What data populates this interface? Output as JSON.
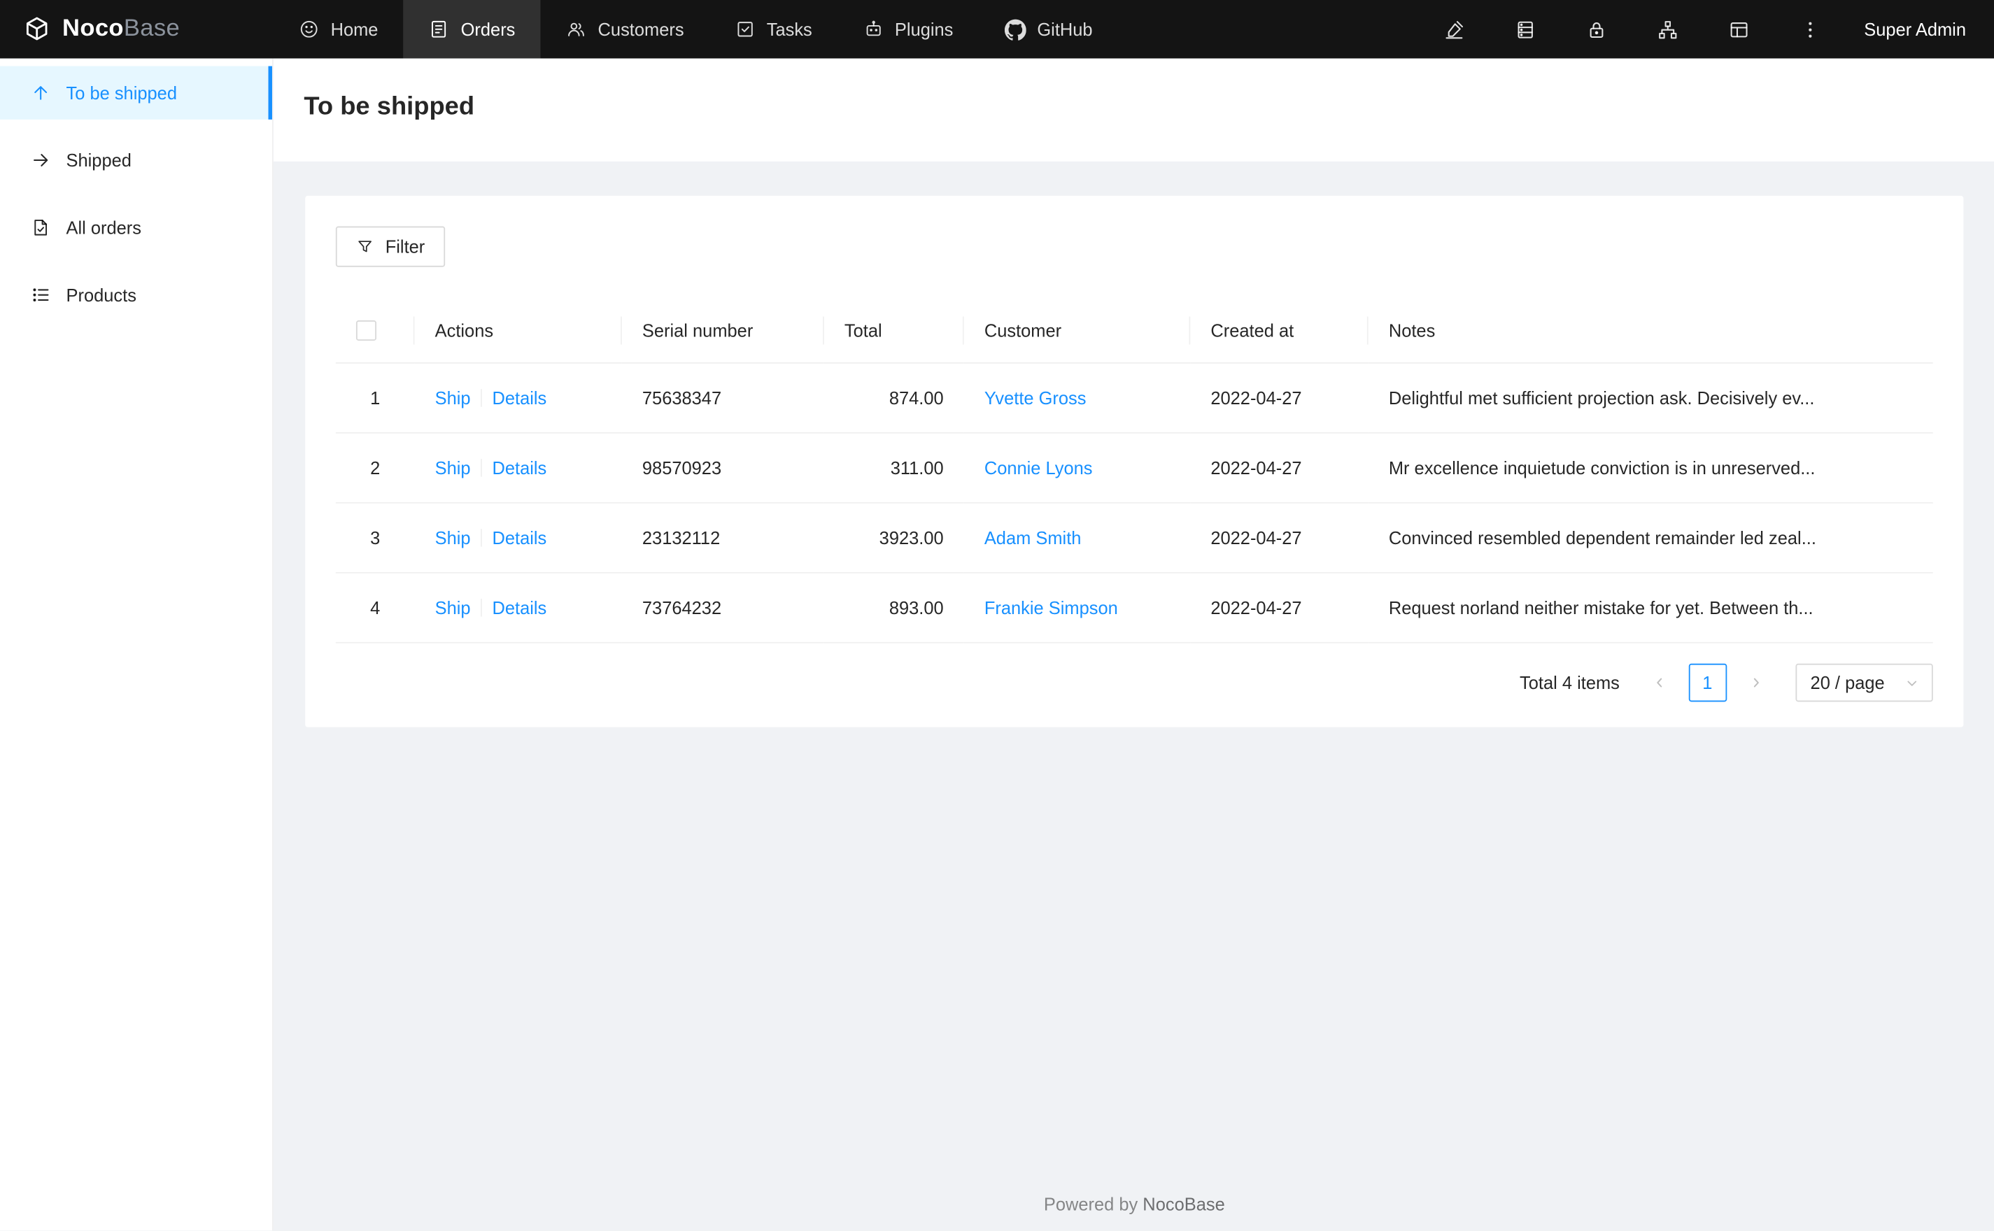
{
  "colors": {
    "accent": "#1890ff",
    "navbar_bg": "#141414",
    "sidebar_active_bg": "#e6f7ff",
    "content_bg": "#f0f2f5"
  },
  "navbar": {
    "brand_primary": "Noco",
    "brand_secondary": "Base",
    "brand_icon": "nocobase-cube-icon",
    "items": [
      {
        "label": "Home",
        "icon": "smile-icon",
        "active": false
      },
      {
        "label": "Orders",
        "icon": "orders-icon",
        "active": true
      },
      {
        "label": "Customers",
        "icon": "customers-icon",
        "active": false
      },
      {
        "label": "Tasks",
        "icon": "tasks-icon",
        "active": false
      },
      {
        "label": "Plugins",
        "icon": "plugins-icon",
        "active": false
      },
      {
        "label": "GitHub",
        "icon": "github-icon",
        "active": false
      }
    ],
    "right_icons": [
      "highlighter-icon",
      "collections-icon",
      "lock-icon",
      "apartment-icon",
      "layout-icon",
      "more-icon"
    ],
    "user": "Super Admin"
  },
  "sidebar": {
    "items": [
      {
        "label": "To be shipped",
        "icon": "arrow-up-icon",
        "active": true
      },
      {
        "label": "Shipped",
        "icon": "arrow-right-icon",
        "active": false
      },
      {
        "label": "All orders",
        "icon": "file-done-icon",
        "active": false
      },
      {
        "label": "Products",
        "icon": "list-icon",
        "active": false
      }
    ]
  },
  "page": {
    "title": "To be shipped"
  },
  "toolbar": {
    "filter_label": "Filter"
  },
  "table": {
    "columns": [
      "Actions",
      "Serial number",
      "Total",
      "Customer",
      "Created at",
      "Notes"
    ],
    "rows": [
      {
        "index": "1",
        "actions": {
          "ship": "Ship",
          "details": "Details"
        },
        "serial": "75638347",
        "total": "874.00",
        "customer": "Yvette Gross",
        "created_at": "2022-04-27",
        "notes": "Delightful met sufficient projection ask. Decisively ev..."
      },
      {
        "index": "2",
        "actions": {
          "ship": "Ship",
          "details": "Details"
        },
        "serial": "98570923",
        "total": "311.00",
        "customer": "Connie Lyons",
        "created_at": "2022-04-27",
        "notes": "Mr excellence inquietude conviction is in unreserved..."
      },
      {
        "index": "3",
        "actions": {
          "ship": "Ship",
          "details": "Details"
        },
        "serial": "23132112",
        "total": "3923.00",
        "customer": "Adam Smith",
        "created_at": "2022-04-27",
        "notes": "Convinced resembled dependent remainder led zeal..."
      },
      {
        "index": "4",
        "actions": {
          "ship": "Ship",
          "details": "Details"
        },
        "serial": "73764232",
        "total": "893.00",
        "customer": "Frankie Simpson",
        "created_at": "2022-04-27",
        "notes": "Request norland neither mistake for yet. Between th..."
      }
    ]
  },
  "pagination": {
    "total_label": "Total 4 items",
    "current_page": "1",
    "page_size_label": "20 / page"
  },
  "footer": {
    "powered_prefix": "Powered by ",
    "brand": "NocoBase"
  }
}
